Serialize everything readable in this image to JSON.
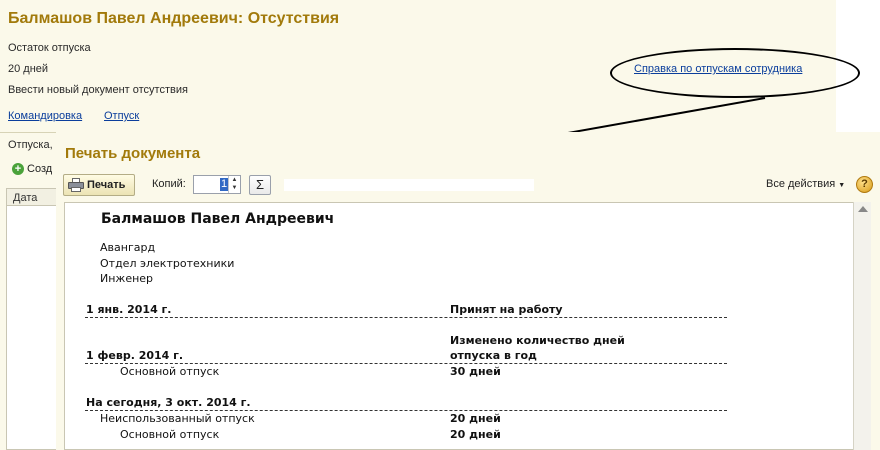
{
  "background": {
    "title": "Балмашов Павел Андреевич: Отсутствия",
    "vacation_balance_label": "Остаток отпуска",
    "vacation_balance_value": "20 дней",
    "new_document_label": "Ввести новый документ отсутствия",
    "link_business_trip": "Командировка",
    "link_vacation": "Отпуск",
    "link_vacation_report": "Справка по отпускам сотрудника",
    "section_label": "Отпуска,",
    "create_button": "Созд",
    "table_header_date": "Дата"
  },
  "dialog": {
    "title": "Печать документа",
    "print_button": "Печать",
    "copies_label": "Копий:",
    "copies_value": "1",
    "sum_symbol": "Σ",
    "all_actions": "Все действия",
    "help_symbol": "?"
  },
  "document": {
    "employee_name": "Балмашов Павел Андреевич",
    "organization": "Авангард",
    "department": "Отдел электротехники",
    "position": "Инженер",
    "events": [
      {
        "date": "1 янв. 2014 г.",
        "event": "Принят на работу"
      },
      {
        "date": "1 февр. 2014 г.",
        "event_line1": "Изменено количество дней",
        "event_line2": "отпуска в год",
        "detail_label": "Основной отпуск",
        "detail_value": "30 дней"
      },
      {
        "date": "На сегодня, 3 окт. 2014 г.",
        "unused_label": "Неиспользованный отпуск",
        "unused_value": "20 дней",
        "detail_label": "Основной отпуск",
        "detail_value": "20 дней"
      }
    ]
  },
  "colors": {
    "title_gold": "#a27a0b",
    "link_blue": "#0b3e9c",
    "window_bg": "#fbf9ea"
  }
}
